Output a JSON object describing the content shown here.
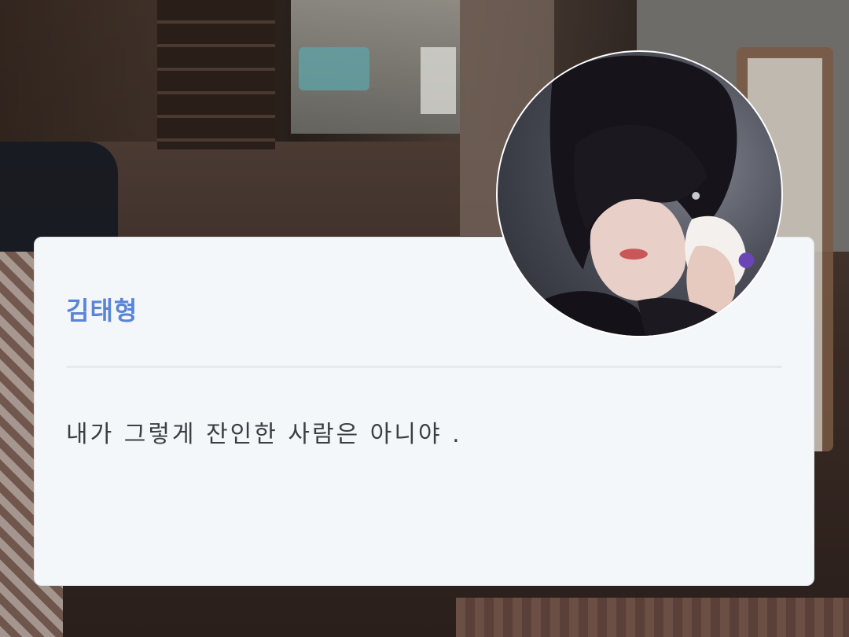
{
  "profile": {
    "name": "김태형",
    "message": "내가 그렇게 잔인한 사람은 아니야 ."
  },
  "colors": {
    "name_color": "#5b84d6",
    "message_color": "#3a3e45",
    "card_background": "#f4f7f9"
  },
  "icons": {
    "avatar": "profile-photo"
  }
}
